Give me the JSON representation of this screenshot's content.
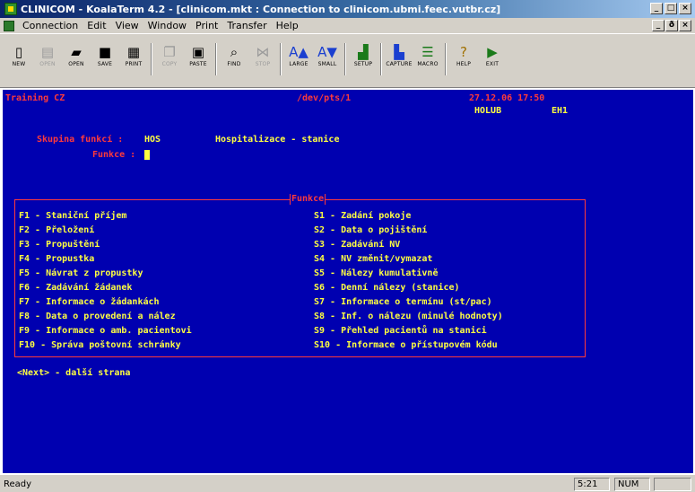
{
  "window": {
    "title": "CLINICOM - KoalaTerm 4.2 - [clinicom.mkt : Connection to clinicom.ubmi.feec.vutbr.cz]",
    "buttons": [
      "_",
      "□",
      "×"
    ],
    "mdi_buttons": [
      "_",
      "ð",
      "×"
    ]
  },
  "menu": [
    "Connection",
    "Edit",
    "View",
    "Window",
    "Print",
    "Transfer",
    "Help"
  ],
  "toolbar": [
    {
      "label": "NEW",
      "icon": "new-doc-icon",
      "glyph": "▯",
      "enabled": true
    },
    {
      "label": "OPEN",
      "icon": "disabled-open-icon",
      "glyph": "▤",
      "enabled": false
    },
    {
      "label": "OPEN",
      "icon": "open-folder-icon",
      "glyph": "▰",
      "enabled": true
    },
    {
      "label": "SAVE",
      "icon": "save-disk-icon",
      "glyph": "■",
      "enabled": true
    },
    {
      "label": "PRINT",
      "icon": "printer-icon",
      "glyph": "▦",
      "enabled": true
    },
    {
      "label": "COPY",
      "icon": "copy-icon",
      "glyph": "❐",
      "enabled": false
    },
    {
      "label": "PASTE",
      "icon": "paste-icon",
      "glyph": "▣",
      "enabled": true
    },
    {
      "label": "FIND",
      "icon": "find-magnifier-icon",
      "glyph": "⌕",
      "enabled": true
    },
    {
      "label": "STOP",
      "icon": "stop-icon",
      "glyph": "⋈",
      "enabled": false
    },
    {
      "label": "LARGE",
      "icon": "large-font-icon",
      "glyph": "A▲",
      "enabled": true
    },
    {
      "label": "SMALL",
      "icon": "small-font-icon",
      "glyph": "A▼",
      "enabled": true
    },
    {
      "label": "SETUP",
      "icon": "setup-icon",
      "glyph": "▟",
      "enabled": true
    },
    {
      "label": "CAPTURE",
      "icon": "capture-icon",
      "glyph": "▙",
      "enabled": true
    },
    {
      "label": "MACRO",
      "icon": "macro-icon",
      "glyph": "☰",
      "enabled": true
    },
    {
      "label": "HELP",
      "icon": "help-icon",
      "glyph": "?",
      "enabled": true
    },
    {
      "label": "EXIT",
      "icon": "exit-icon",
      "glyph": "▶",
      "enabled": true
    }
  ],
  "terminal": {
    "header_left": "Training CZ",
    "device": "/dev/pts/1",
    "datetime": "27.12.06 17:50",
    "user": "HOLUB",
    "terminal_id": "EH1",
    "skupina_label": "Skupina funkcí :",
    "skupina_value": "HOS",
    "skupina_desc": "Hospitalizace - stanice",
    "funkce_label": "Funkce :",
    "box_title": "Funkce",
    "functions_left": [
      "F1 - Staniční příjem",
      "F2 - Přeložení",
      "F3 - Propuštění",
      "F4 - Propustka",
      "F5 - Návrat z propustky",
      "F6 - Zadávání žádanek",
      "F7 - Informace o žádankách",
      "F8 - Data o provedení a nález",
      "F9 - Informace o amb. pacientovi",
      "F10 - Správa poštovní schránky"
    ],
    "functions_right": [
      "S1 - Zadání pokoje",
      "S2 - Data o pojištění",
      "S3 - Zadávání NV",
      "S4 - NV změnit/vymazat",
      "S5 - Nálezy kumulativně",
      "S6 - Denní nálezy (stanice)",
      "S7 - Informace o termínu (st/pac)",
      "S8 - Inf. o nálezu (minulé hodnoty)",
      "S9 - Přehled pacientů na stanici",
      "S10 - Informace o přístupovém kódu"
    ],
    "next_hint": "<Next> - další strana"
  },
  "status": {
    "ready": "Ready",
    "position": "5:21",
    "num": "NUM"
  },
  "colors": {
    "terminal_bg": "#0000b0",
    "text_yellow": "#ffff40",
    "text_red": "#ff3a3a"
  }
}
